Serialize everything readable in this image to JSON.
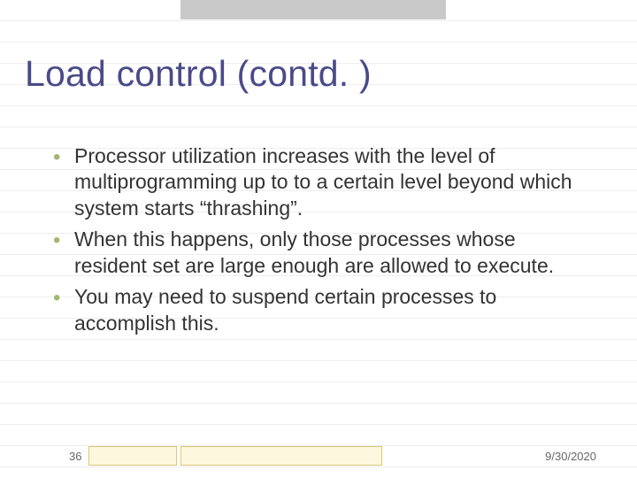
{
  "title": "Load control (contd. )",
  "bullets": [
    "Processor utilization increases with the level of multiprogramming up to to a certain level beyond which system starts “thrashing”.",
    "When this happens, only those processes whose resident set are large enough are allowed to execute.",
    "You may need to suspend certain processes to accomplish this."
  ],
  "page_number": "36",
  "date": "9/30/2020"
}
